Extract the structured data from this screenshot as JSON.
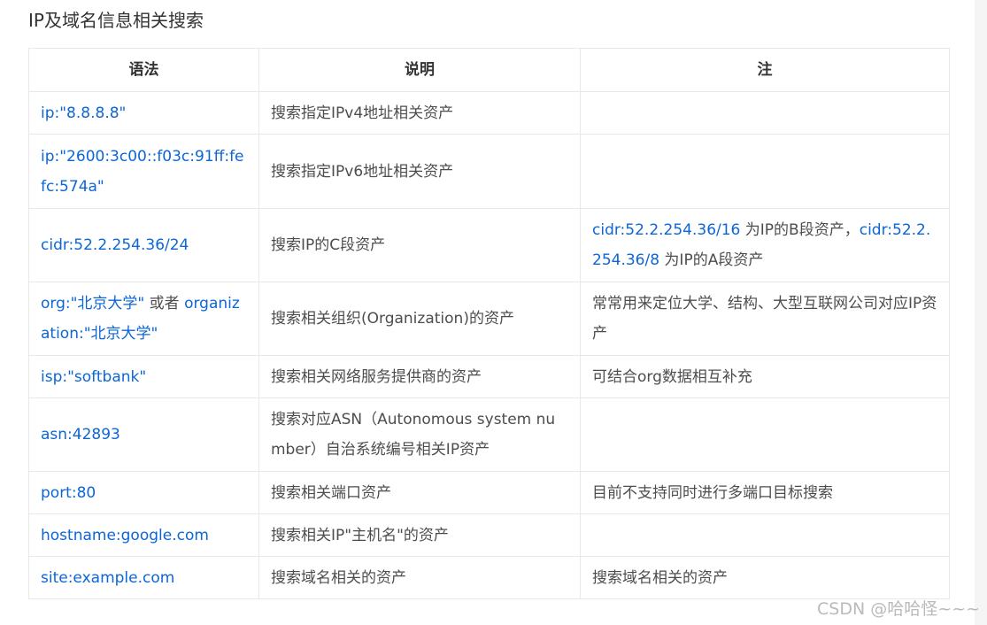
{
  "heading": "IP及域名信息相关搜索",
  "table": {
    "headers": [
      "语法",
      "说明",
      "注"
    ],
    "rows": [
      {
        "syntax": "ip:\"8.8.8.8\"",
        "desc": "搜索指定IPv4地址相关资产",
        "note": []
      },
      {
        "syntax": "ip:\"2600:3c00::f03c:91ff:fefc:574a\"",
        "desc": "搜索指定IPv6地址相关资产",
        "note": []
      },
      {
        "syntax": "cidr:52.2.254.36/24",
        "desc": "搜索IP的C段资产",
        "note": [
          {
            "text": "cidr:52.2.254.36/16",
            "link": true
          },
          {
            "text": " 为IP的B段资产，",
            "link": false
          },
          {
            "text": "cidr:52.2.254.36/8",
            "link": true
          },
          {
            "text": " 为IP的A段资产",
            "link": false
          }
        ]
      },
      {
        "syntax_parts": [
          {
            "text": "org:\"北京大学\"",
            "link": true
          },
          {
            "text": " 或者 ",
            "link": false
          },
          {
            "text": "organization:\"北京大学\"",
            "link": true
          }
        ],
        "desc": "搜索相关组织(Organization)的资产",
        "note": [
          {
            "text": "常常用来定位大学、结构、大型互联网公司对应IP资产",
            "link": false
          }
        ]
      },
      {
        "syntax": "isp:\"softbank\"",
        "desc": "搜索相关网络服务提供商的资产",
        "note": [
          {
            "text": "可结合org数据相互补充",
            "link": false
          }
        ]
      },
      {
        "syntax": "asn:42893",
        "desc": "搜索对应ASN（Autonomous system number）自治系统编号相关IP资产",
        "note": []
      },
      {
        "syntax": "port:80",
        "desc": "搜索相关端口资产",
        "note": [
          {
            "text": "目前不支持同时进行多端口目标搜索",
            "link": false
          }
        ]
      },
      {
        "syntax": "hostname:google.com",
        "desc": "搜索相关IP\"主机名\"的资产",
        "note": []
      },
      {
        "syntax": "site:example.com",
        "desc": "搜索域名相关的资产",
        "note": [
          {
            "text": "搜索域名相关的资产",
            "link": false
          }
        ]
      }
    ]
  },
  "watermark": "CSDN @哈哈怪~~~"
}
